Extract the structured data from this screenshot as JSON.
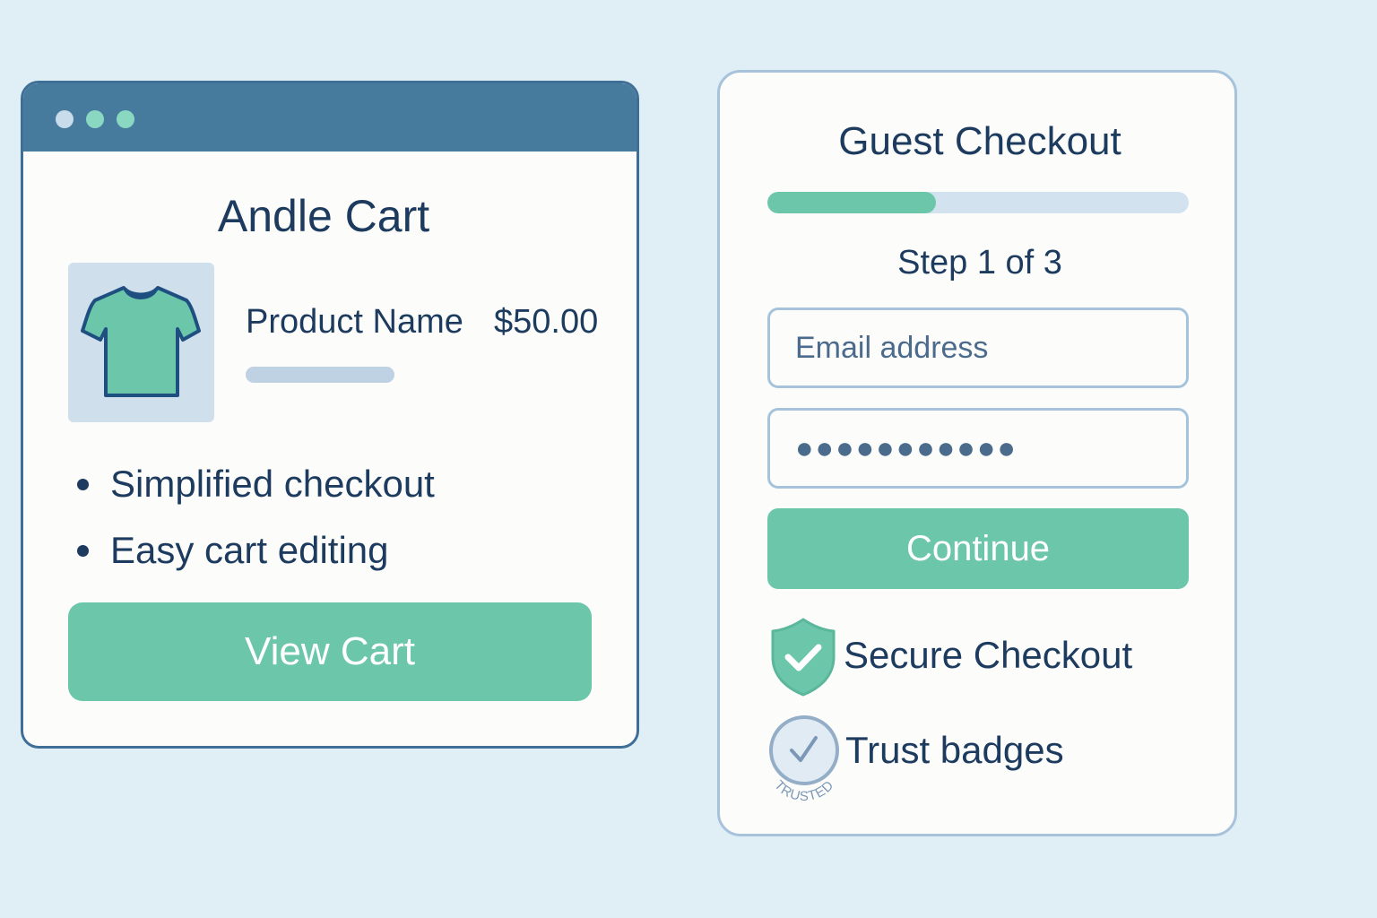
{
  "colors": {
    "background": "#e0eef6",
    "primary_green": "#6cc6aa",
    "navy_text": "#1d3b5e",
    "titlebar_blue": "#477b9e",
    "dot_color_1": "#c9dceb",
    "dot_color_2": "#8ad8c2",
    "dot_color_3": "#8ad8c2"
  },
  "cart_window": {
    "title": "Andle Cart",
    "product": {
      "image_icon": "t-shirt-icon",
      "name": "Product Name",
      "price": "$50.00"
    },
    "features": [
      "Simplified checkout",
      "Easy cart editing"
    ],
    "button_label": "View Cart"
  },
  "checkout": {
    "title": "Guest Checkout",
    "progress_fraction": 0.4,
    "step_label": "Step 1 of 3",
    "email_placeholder": "Email address",
    "password_value": "●●●●●●●●●●●",
    "button_label": "Continue",
    "secure_icon": "shield-check-icon",
    "secure_label": "Secure Checkout",
    "trust_icon": "trusted-badge-icon",
    "trust_label": "Trust badges",
    "badge_text": "TRUSTED"
  }
}
